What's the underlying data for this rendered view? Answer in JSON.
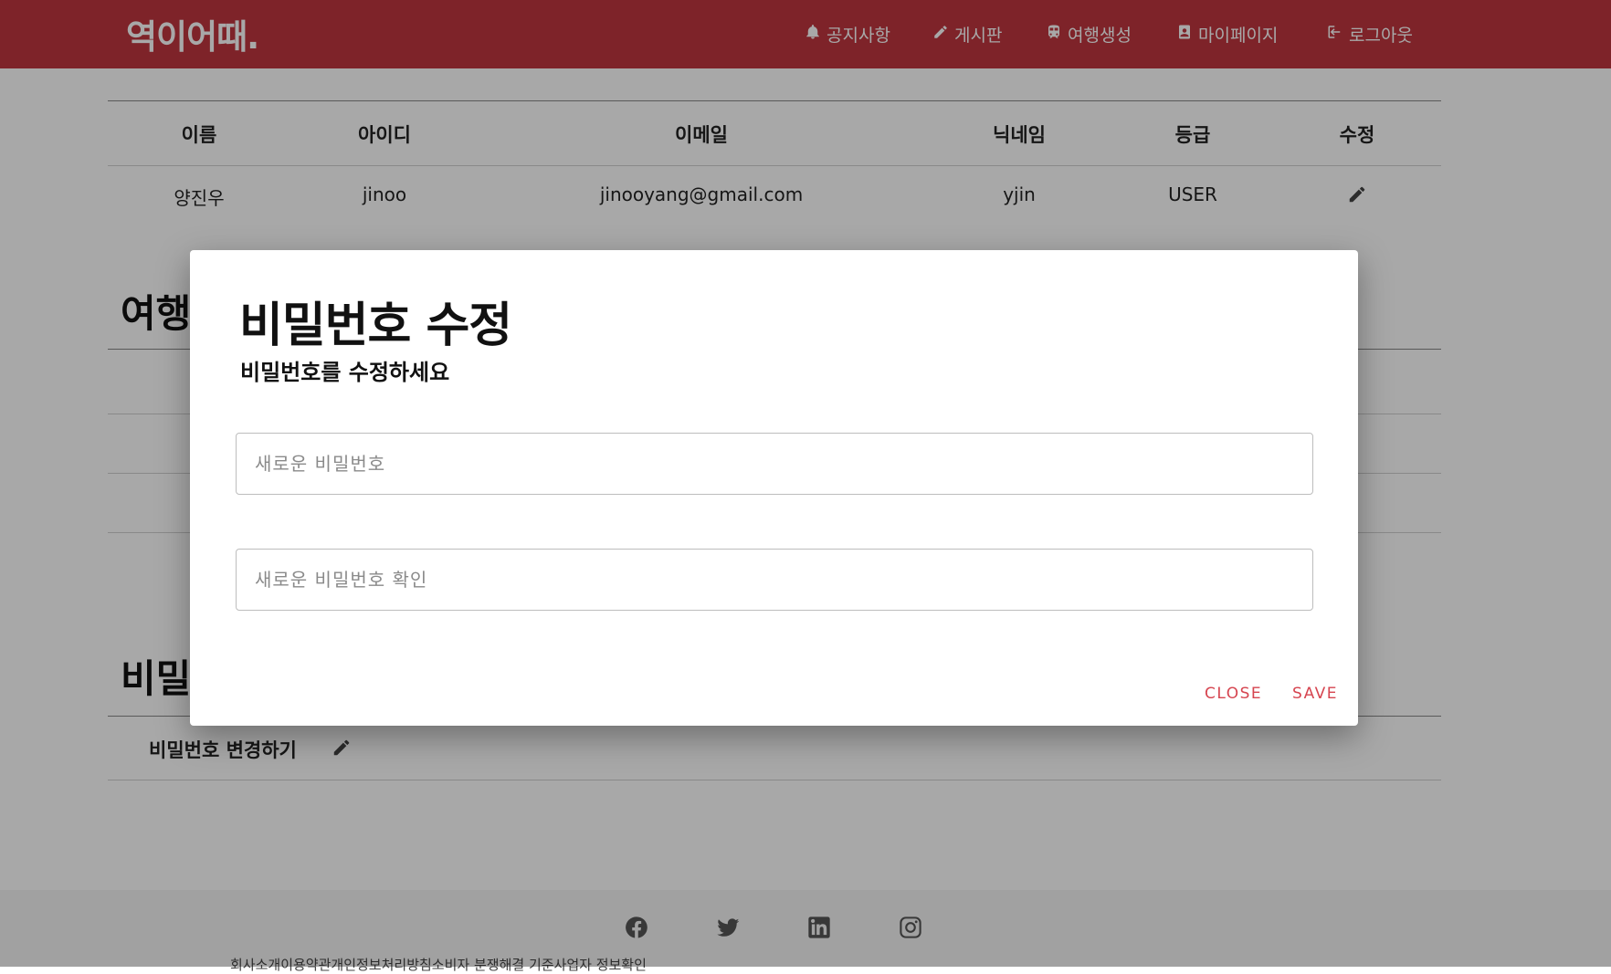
{
  "brand": {
    "logo": "역이어때."
  },
  "nav": [
    {
      "label": "공지사항",
      "icon": "bell-icon"
    },
    {
      "label": "게시판",
      "icon": "pencil-icon"
    },
    {
      "label": "여행생성",
      "icon": "train-icon"
    },
    {
      "label": "마이페이지",
      "icon": "id-badge-icon"
    },
    {
      "label": "로그아웃",
      "icon": "logout-icon"
    }
  ],
  "member": {
    "headers": [
      "이름",
      "아이디",
      "이메일",
      "닉네임",
      "등급",
      "수정"
    ],
    "row": {
      "name": "양진우",
      "id": "jinoo",
      "email": "jinooyang@gmail.com",
      "nickname": "yjin",
      "grade": "USER"
    }
  },
  "sections": {
    "travel_title_partial": "여행",
    "password_title_partial": "비밀",
    "password_change_label": "비밀번호 변경하기"
  },
  "modal": {
    "title": "비밀번호 수정",
    "subtitle": "비밀번호를 수정하세요",
    "new_password_placeholder": "새로운 비밀번호",
    "confirm_password_placeholder": "새로운 비밀번호 확인",
    "close_label": "CLOSE",
    "save_label": "SAVE"
  },
  "footer": {
    "social": [
      "facebook-icon",
      "twitter-icon",
      "linkedin-icon",
      "instagram-icon"
    ],
    "text": "회사소개이용약관개인정보처리방침소비자 분쟁해결 기준사업자 정보확인"
  },
  "colors": {
    "brand": "#c0363f",
    "modal_button": "#d64550"
  }
}
